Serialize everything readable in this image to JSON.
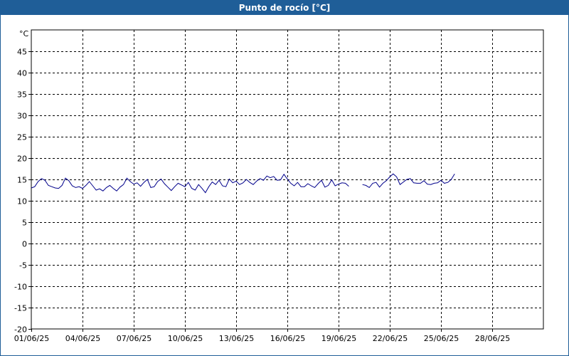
{
  "window": {
    "title": "Punto de rocío [°C]"
  },
  "chart_data": {
    "type": "line",
    "title": "Punto de rocío [°C]",
    "ylabel": "°C",
    "xlabel": "",
    "ylim": [
      -20,
      50
    ],
    "yticks": [
      45,
      40,
      35,
      30,
      25,
      20,
      15,
      10,
      5,
      0,
      -5,
      -10,
      -15,
      -20
    ],
    "xlim_days": [
      1,
      31
    ],
    "xticks": [
      {
        "day": 1,
        "label": "01/06/25"
      },
      {
        "day": 4,
        "label": "04/06/25"
      },
      {
        "day": 7,
        "label": "07/06/25"
      },
      {
        "day": 10,
        "label": "10/06/25"
      },
      {
        "day": 13,
        "label": "13/06/25"
      },
      {
        "day": 16,
        "label": "16/06/25"
      },
      {
        "day": 19,
        "label": "19/06/25"
      },
      {
        "day": 22,
        "label": "22/06/25"
      },
      {
        "day": 25,
        "label": "25/06/25"
      },
      {
        "day": 28,
        "label": "28/06/25"
      }
    ],
    "grid": true,
    "line_color": "#00008b",
    "series": [
      {
        "segments": [
          [
            [
              1.0,
              13.0
            ],
            [
              1.2,
              13.3
            ],
            [
              1.4,
              14.5
            ],
            [
              1.6,
              15.2
            ],
            [
              1.8,
              14.8
            ],
            [
              2.0,
              13.6
            ],
            [
              2.2,
              13.3
            ],
            [
              2.4,
              13.0
            ],
            [
              2.6,
              12.9
            ],
            [
              2.8,
              13.6
            ],
            [
              3.0,
              15.3
            ],
            [
              3.2,
              14.7
            ],
            [
              3.4,
              13.5
            ],
            [
              3.6,
              13.1
            ],
            [
              3.8,
              13.3
            ],
            [
              4.0,
              12.9
            ],
            [
              4.2,
              13.6
            ],
            [
              4.4,
              14.5
            ],
            [
              4.6,
              13.5
            ],
            [
              4.8,
              12.5
            ],
            [
              5.0,
              12.8
            ],
            [
              5.2,
              12.3
            ],
            [
              5.4,
              13.1
            ],
            [
              5.6,
              13.6
            ],
            [
              5.8,
              12.9
            ],
            [
              6.0,
              12.3
            ],
            [
              6.2,
              13.2
            ],
            [
              6.4,
              13.8
            ],
            [
              6.6,
              15.3
            ],
            [
              6.8,
              14.5
            ],
            [
              7.0,
              13.9
            ],
            [
              7.2,
              14.2
            ],
            [
              7.4,
              13.4
            ],
            [
              7.6,
              14.3
            ],
            [
              7.8,
              15.0
            ],
            [
              8.0,
              13.1
            ],
            [
              8.2,
              13.3
            ],
            [
              8.4,
              14.5
            ],
            [
              8.6,
              15.1
            ],
            [
              8.8,
              14.0
            ],
            [
              9.0,
              13.2
            ],
            [
              9.2,
              12.4
            ],
            [
              9.4,
              13.3
            ],
            [
              9.6,
              14.1
            ],
            [
              9.8,
              13.7
            ],
            [
              10.0,
              13.3
            ],
            [
              10.2,
              14.3
            ],
            [
              10.4,
              12.9
            ],
            [
              10.6,
              12.5
            ],
            [
              10.8,
              13.8
            ],
            [
              11.0,
              12.9
            ],
            [
              11.2,
              11.9
            ],
            [
              11.4,
              13.3
            ],
            [
              11.6,
              14.4
            ],
            [
              11.8,
              13.8
            ],
            [
              12.0,
              14.8
            ],
            [
              12.2,
              13.5
            ],
            [
              12.4,
              13.3
            ],
            [
              12.6,
              15.1
            ],
            [
              12.8,
              14.2
            ],
            [
              13.0,
              14.6
            ],
            [
              13.2,
              13.8
            ],
            [
              13.4,
              14.2
            ],
            [
              13.6,
              15.0
            ],
            [
              13.8,
              14.3
            ],
            [
              14.0,
              13.8
            ],
            [
              14.2,
              14.6
            ],
            [
              14.4,
              15.2
            ],
            [
              14.6,
              14.8
            ],
            [
              14.8,
              15.8
            ],
            [
              15.0,
              15.4
            ],
            [
              15.2,
              15.7
            ],
            [
              15.4,
              14.8
            ],
            [
              15.6,
              14.9
            ],
            [
              15.8,
              16.2
            ],
            [
              16.0,
              15.1
            ],
            [
              16.2,
              14.1
            ],
            [
              16.4,
              13.5
            ],
            [
              16.6,
              14.3
            ],
            [
              16.8,
              13.3
            ],
            [
              17.0,
              13.3
            ],
            [
              17.2,
              14.0
            ],
            [
              17.4,
              13.5
            ],
            [
              17.6,
              13.1
            ],
            [
              17.8,
              14.0
            ],
            [
              18.0,
              14.8
            ],
            [
              18.2,
              13.2
            ],
            [
              18.4,
              13.6
            ],
            [
              18.6,
              14.9
            ],
            [
              18.8,
              13.5
            ],
            [
              19.0,
              13.9
            ],
            [
              19.2,
              14.2
            ],
            [
              19.4,
              14.1
            ],
            [
              19.6,
              13.4
            ]
          ],
          [
            [
              20.4,
              13.8
            ],
            [
              20.6,
              13.6
            ],
            [
              20.8,
              13.1
            ],
            [
              21.0,
              14.1
            ],
            [
              21.2,
              14.3
            ],
            [
              21.4,
              13.2
            ],
            [
              21.6,
              14.1
            ],
            [
              21.8,
              14.7
            ],
            [
              22.0,
              15.6
            ],
            [
              22.2,
              16.3
            ],
            [
              22.4,
              15.6
            ],
            [
              22.6,
              13.8
            ],
            [
              22.8,
              14.4
            ],
            [
              23.0,
              15.0
            ],
            [
              23.2,
              15.2
            ],
            [
              23.4,
              14.2
            ],
            [
              23.6,
              14.1
            ],
            [
              23.8,
              14.1
            ],
            [
              24.0,
              14.7
            ],
            [
              24.2,
              13.9
            ],
            [
              24.4,
              13.8
            ],
            [
              24.6,
              14.1
            ],
            [
              24.8,
              14.2
            ],
            [
              25.0,
              14.8
            ],
            [
              25.2,
              14.1
            ],
            [
              25.4,
              14.3
            ],
            [
              25.6,
              15.0
            ],
            [
              25.8,
              16.3
            ]
          ]
        ]
      }
    ]
  }
}
